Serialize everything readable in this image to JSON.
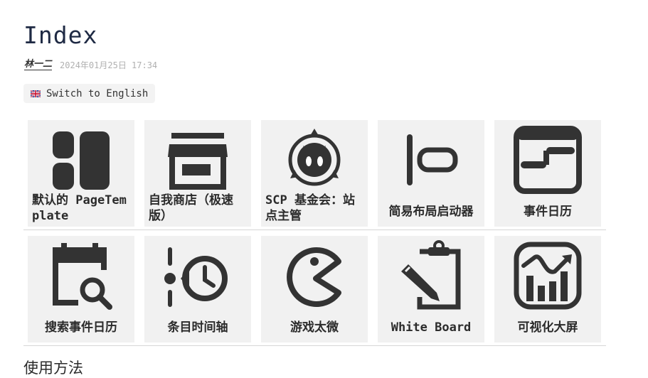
{
  "page": {
    "title": "Index",
    "author": "林一二",
    "date": "2024年01月25日 17:34",
    "language_button": "Switch to English",
    "flag_icon": "uk-flag-icon",
    "section_heading": "使用方法"
  },
  "tiles": [
    {
      "label": "默认的 PageTemplate",
      "icon": "layout-panels-icon"
    },
    {
      "label": "自我商店（极速版）",
      "icon": "store-icon"
    },
    {
      "label": "SCP 基金会：站点主管",
      "icon": "scp-logo-icon"
    },
    {
      "label": "简易布局启动器",
      "icon": "align-left-icon"
    },
    {
      "label": "事件日历",
      "icon": "timeline-calendar-icon"
    },
    {
      "label": "搜索事件日历",
      "icon": "calendar-search-icon"
    },
    {
      "label": "条目时间轴",
      "icon": "timeline-clock-icon"
    },
    {
      "label": "游戏太微",
      "icon": "pacman-icon"
    },
    {
      "label": "White Board",
      "icon": "clipboard-pencil-icon"
    },
    {
      "label": "可视化大屏",
      "icon": "chart-dashboard-icon"
    }
  ],
  "colors": {
    "tile_bg": "#f1f1f1",
    "icon": "#333333",
    "title": "#1f2a44"
  }
}
